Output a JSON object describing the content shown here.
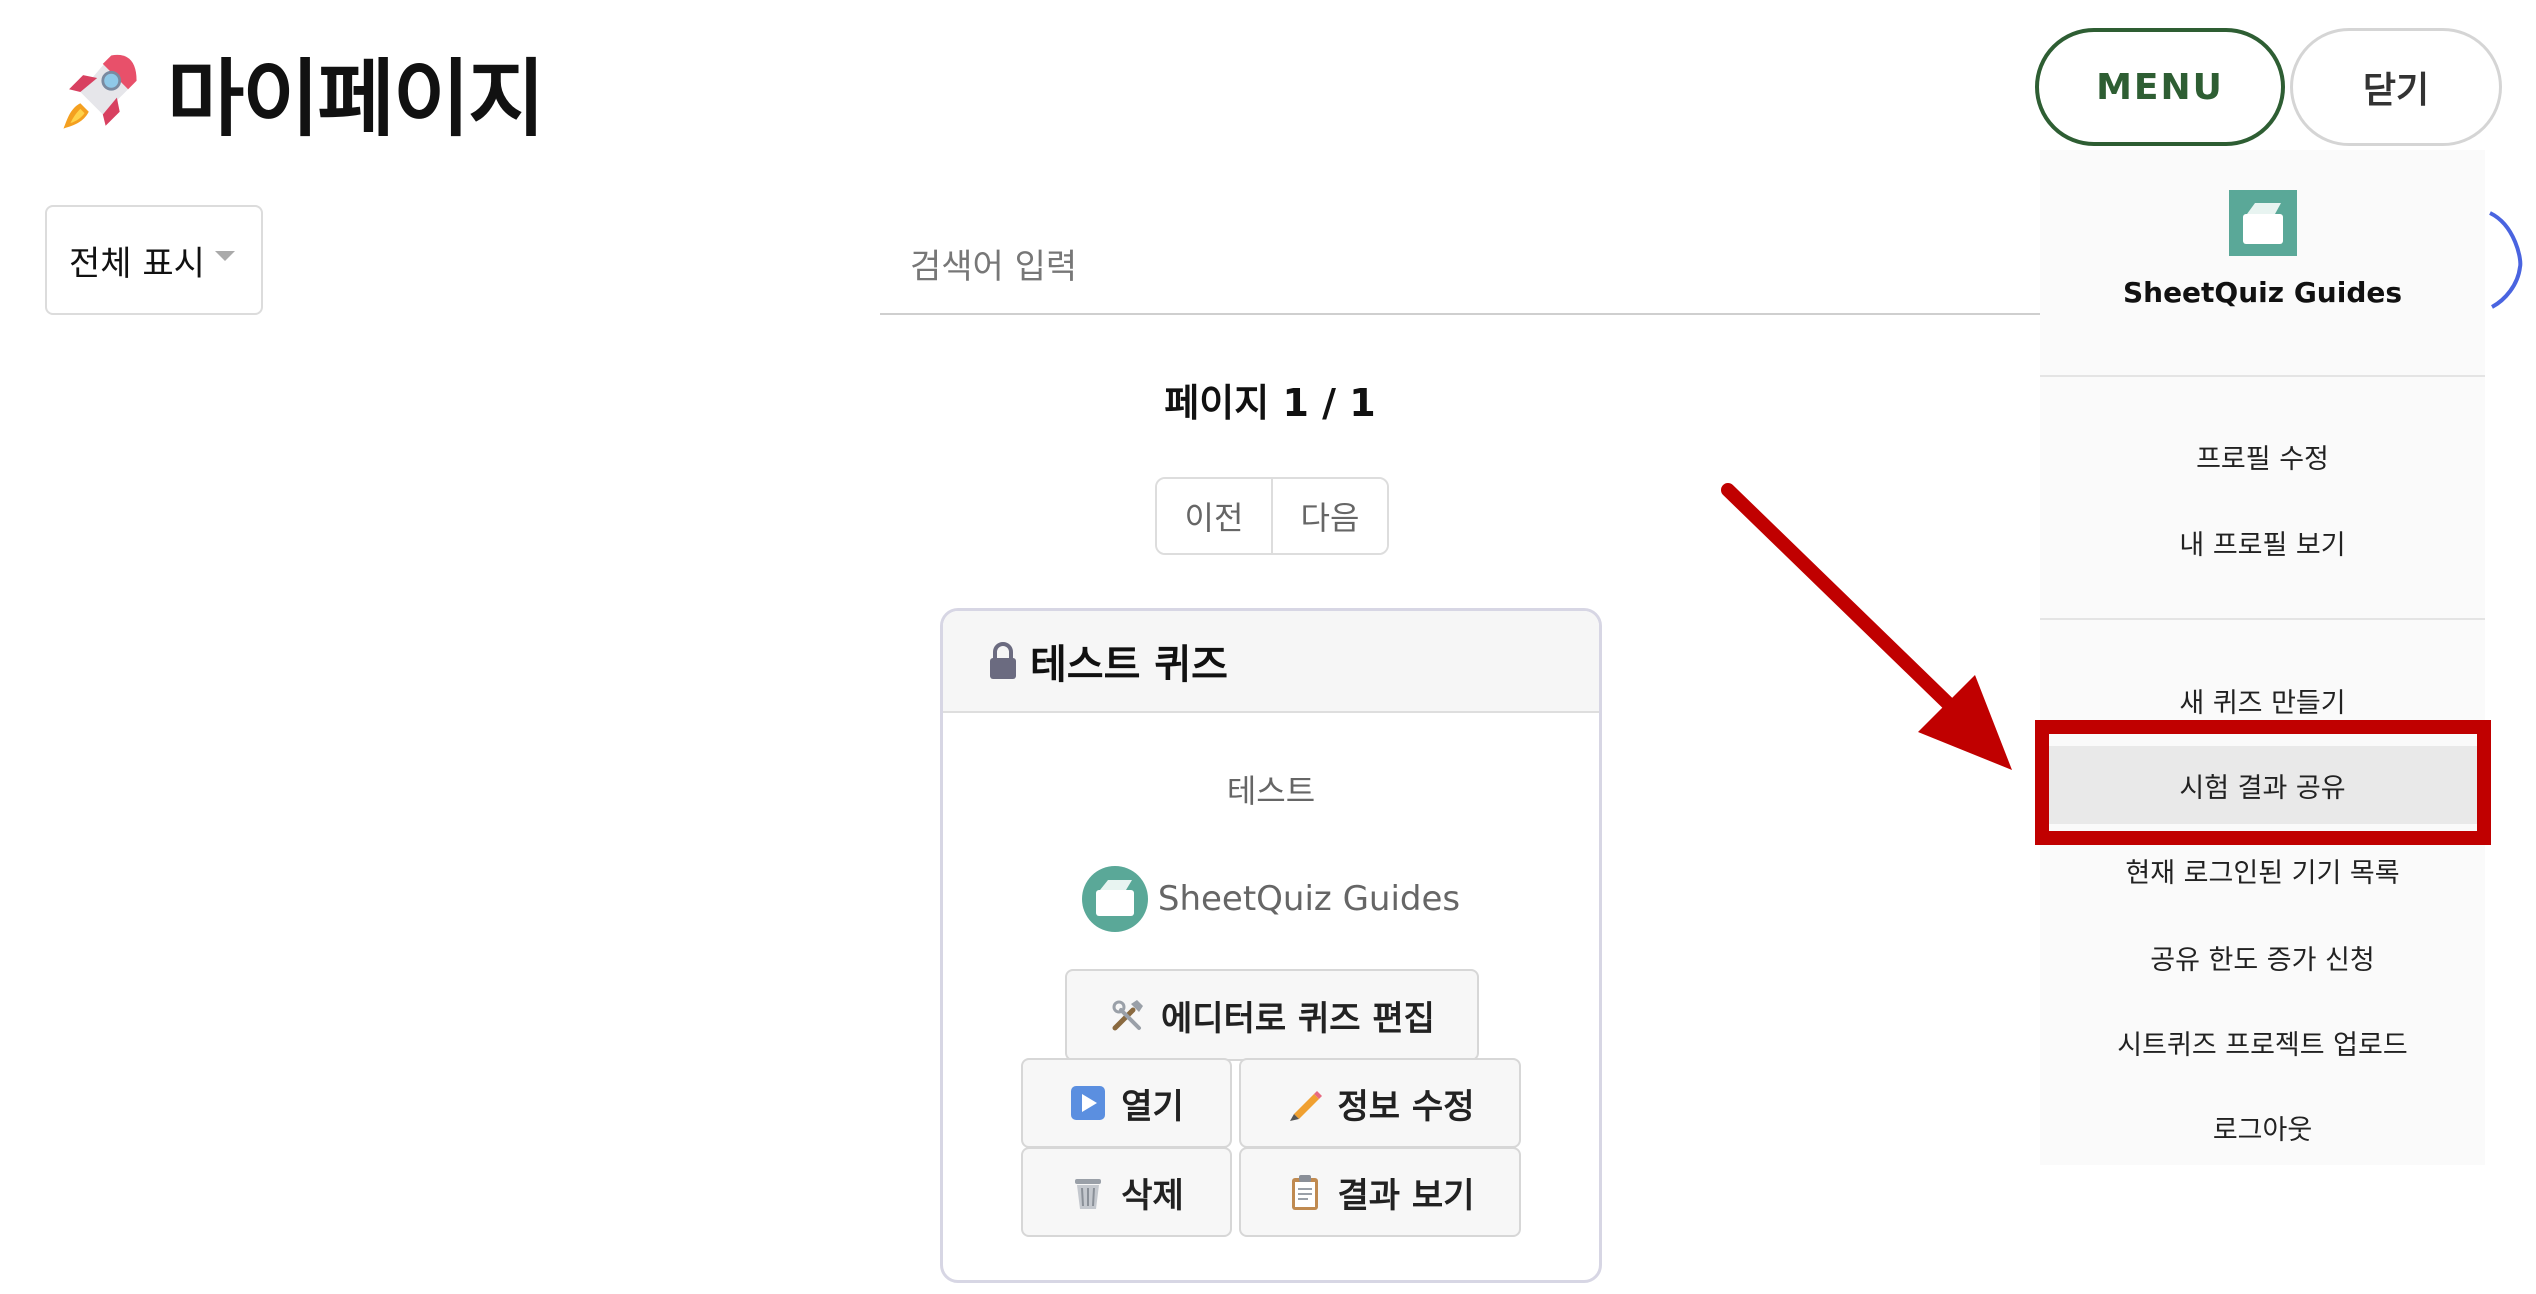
{
  "header": {
    "title": "마이페이지",
    "menu_label": "MENU",
    "close_label": "닫기"
  },
  "filter": {
    "selected": "전체 표시"
  },
  "search": {
    "placeholder": "검색어 입력"
  },
  "pagination": {
    "indicator": "페이지 1 / 1",
    "prev_label": "이전",
    "next_label": "다음"
  },
  "quiz_card": {
    "title": "테스트 퀴즈",
    "description": "테스트",
    "creator": "SheetQuiz Guides",
    "buttons": {
      "edit": "에디터로 퀴즈 편집",
      "open": "열기",
      "info": "정보 수정",
      "delete": "삭제",
      "results": "결과 보기"
    }
  },
  "menu": {
    "brand": "SheetQuiz Guides",
    "profile_items": [
      "프로필 수정",
      "내 프로필 보기"
    ],
    "items": [
      "새 퀴즈 만들기",
      "시험 결과 공유",
      "현재 로그인된 기기 목록",
      "공유 한도 증가 신청",
      "시트퀴즈 프로젝트 업로드",
      "로그아웃"
    ],
    "highlighted_item": "시험 결과 공유"
  },
  "colors": {
    "menu_green": "#2e5e33",
    "annotation_red": "#c00000",
    "brand_teal": "#5aa898",
    "search_accent": "#4a64e0"
  },
  "icons": [
    "rocket-icon",
    "lock-icon",
    "tools-icon",
    "play-icon",
    "pencil-icon",
    "trash-icon",
    "clipboard-icon",
    "folder-logo-icon"
  ]
}
